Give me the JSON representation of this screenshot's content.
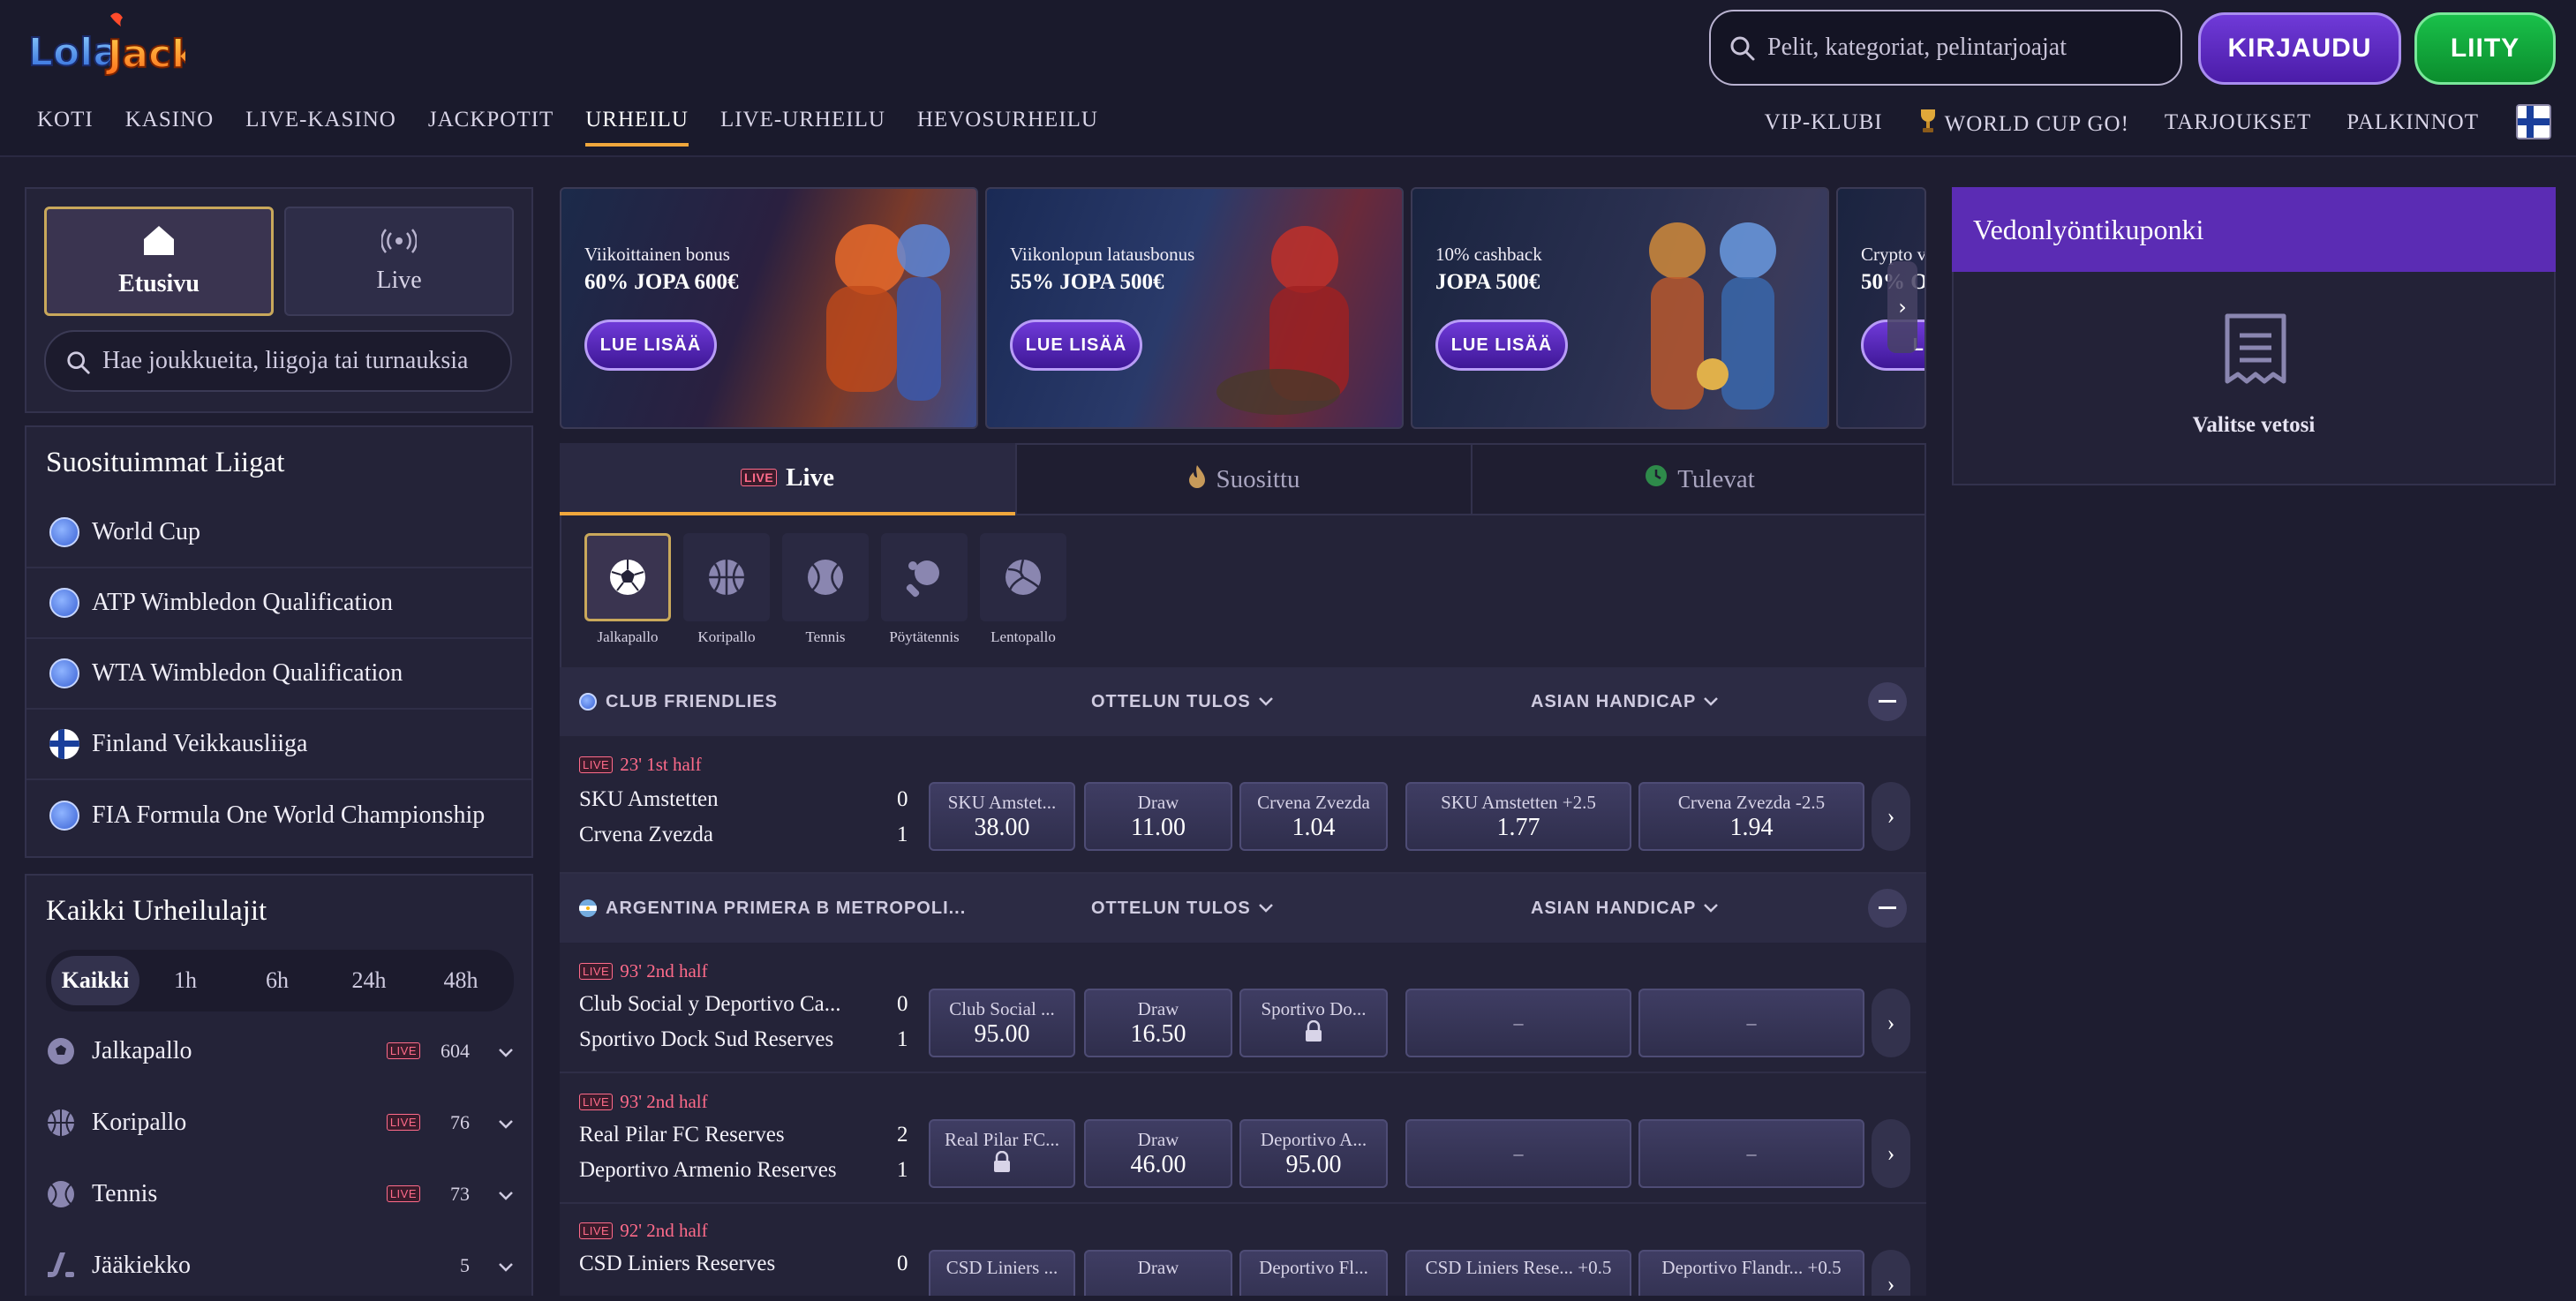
{
  "brand": {
    "logo_text": "LolaJack"
  },
  "header": {
    "search_placeholder": "Pelit, kategoriat, pelintarjoajat",
    "login": "KIRJAUDU",
    "join": "LIITY",
    "nav": [
      "KOTI",
      "KASINO",
      "LIVE-KASINO",
      "JACKPOTIT",
      "URHEILU",
      "LIVE-URHEILU",
      "HEVOSURHEILU"
    ],
    "right_nav": [
      "VIP-KLUBI",
      "WORLD CUP GO!",
      "TARJOUKSET",
      "PALKINNOT"
    ]
  },
  "left": {
    "tab_home": "Etusivu",
    "tab_live": "Live",
    "search_placeholder": "Hae joukkueita, liigoja tai turnauksia",
    "popular_title": "Suosituimmat Liigat",
    "leagues": [
      "World Cup",
      "ATP Wimbledon Qualification",
      "WTA Wimbledon Qualification",
      "Finland Veikkausliiga",
      "FIA Formula One World Championship"
    ],
    "all_title": "Kaikki Urheilulajit",
    "filters": [
      "Kaikki",
      "1h",
      "6h",
      "24h",
      "48h"
    ],
    "sports": [
      {
        "name": "Jalkapallo",
        "live": "LIVE",
        "count": "604"
      },
      {
        "name": "Koripallo",
        "live": "LIVE",
        "count": "76"
      },
      {
        "name": "Tennis",
        "live": "LIVE",
        "count": "73"
      },
      {
        "name": "Jääkiekko",
        "live": "",
        "count": "5"
      }
    ]
  },
  "banners": [
    {
      "sub": "Viikoittainen bonus",
      "main": "60% JOPA 600€",
      "btn": "LUE LISÄÄ"
    },
    {
      "sub": "Viikonlopun latausbonus",
      "main": "55% JOPA 500€",
      "btn": "LUE LISÄÄ"
    },
    {
      "sub": "10% cashback",
      "main": "JOPA 500€",
      "btn": "LUE LISÄÄ"
    },
    {
      "sub": "Crypto v",
      "main": "50% O",
      "btn": "L L"
    }
  ],
  "market_tabs": {
    "live_badge": "LIVE",
    "live": "Live",
    "popular": "Suosittu",
    "upcoming": "Tulevat"
  },
  "sport_filters": [
    "Jalkapallo",
    "Koripallo",
    "Tennis",
    "Pöytätennis",
    "Lentopallo"
  ],
  "sections": [
    {
      "league": "CLUB FRIENDLIES",
      "market1": "OTTELUN TULOS",
      "market2": "ASIAN HANDICAP",
      "matches": [
        {
          "live": "LIVE",
          "time": "23' 1st half",
          "home": "SKU Amstetten",
          "away": "Crvena Zvezda",
          "home_score": "0",
          "away_score": "1",
          "odds": [
            {
              "label": "SKU Amstet...",
              "value": "38.00"
            },
            {
              "label": "Draw",
              "value": "11.00"
            },
            {
              "label": "Crvena Zvezda",
              "value": "1.04"
            },
            {
              "label": "SKU Amstetten +2.5",
              "value": "1.77"
            },
            {
              "label": "Crvena Zvezda -2.5",
              "value": "1.94"
            }
          ]
        }
      ]
    },
    {
      "league": "ARGENTINA PRIMERA B METROPOLI...",
      "market1": "OTTELUN TULOS",
      "market2": "ASIAN HANDICAP",
      "matches": [
        {
          "live": "LIVE",
          "time": "93' 2nd half",
          "home": "Club Social y Deportivo Ca...",
          "away": "Sportivo Dock Sud Reserves",
          "home_score": "0",
          "away_score": "1",
          "odds": [
            {
              "label": "Club Social ...",
              "value": "95.00"
            },
            {
              "label": "Draw",
              "value": "16.50"
            },
            {
              "label": "Sportivo Do...",
              "value": ""
            },
            {
              "label": "",
              "value": "–"
            },
            {
              "label": "",
              "value": "–"
            }
          ]
        },
        {
          "live": "LIVE",
          "time": "93' 2nd half",
          "home": "Real Pilar FC Reserves",
          "away": "Deportivo Armenio Reserves",
          "home_score": "2",
          "away_score": "1",
          "odds": [
            {
              "label": "Real Pilar FC...",
              "value": ""
            },
            {
              "label": "Draw",
              "value": "46.00"
            },
            {
              "label": "Deportivo A...",
              "value": "95.00"
            },
            {
              "label": "",
              "value": "–"
            },
            {
              "label": "",
              "value": "–"
            }
          ]
        },
        {
          "live": "LIVE",
          "time": "92' 2nd half",
          "home": "CSD Liniers Reserves",
          "away": "",
          "home_score": "0",
          "away_score": "",
          "odds": [
            {
              "label": "CSD Liniers ...",
              "value": ""
            },
            {
              "label": "Draw",
              "value": ""
            },
            {
              "label": "Deportivo Fl...",
              "value": ""
            },
            {
              "label": "CSD Liniers Rese... +0.5",
              "value": ""
            },
            {
              "label": "Deportivo Flandr... +0.5",
              "value": ""
            }
          ]
        }
      ]
    }
  ],
  "coupon": {
    "title": "Vedonlyöntikuponki",
    "empty": "Valitse vetosi"
  }
}
